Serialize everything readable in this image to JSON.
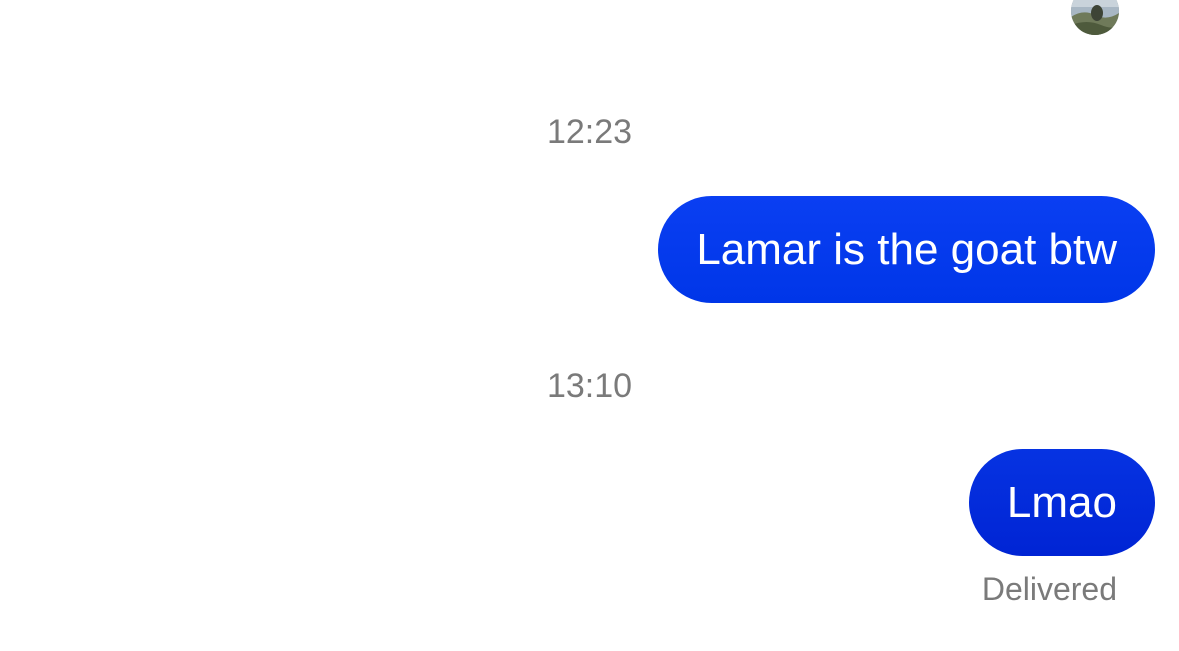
{
  "conversation": {
    "messages": [
      {
        "timestamp": "12:23",
        "text": "Lamar is the goat btw"
      },
      {
        "timestamp": "13:10",
        "text": "Lmao",
        "status": "Delivered"
      }
    ]
  },
  "colors": {
    "bubble_top": "#0a3ff2",
    "bubble_bottom": "#0024d4",
    "meta_text": "#7a7a7a",
    "background": "#ffffff"
  },
  "icons": {
    "avatar": "contact-avatar-photo"
  }
}
